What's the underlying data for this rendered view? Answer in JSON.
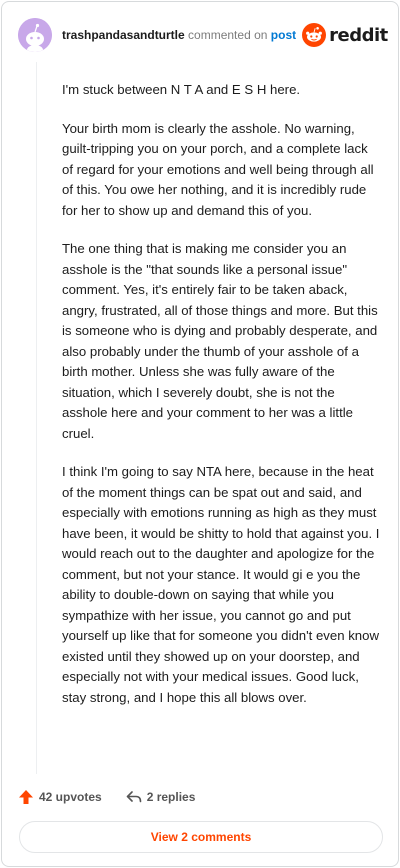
{
  "header": {
    "author": "trashpandasandturtle",
    "commented_on": "commented on",
    "post_link": "post",
    "brand": "reddit"
  },
  "comment": {
    "paragraphs": [
      "I'm stuck between N T A and E S H here.",
      "Your birth mom is clearly the asshole. No warning, guilt-tripping you on your porch, and a complete lack of regard for your emotions and well being through all of this. You owe her nothing, and it is incredibly rude for her to show up and demand this of you.",
      "The one thing that is making me consider you an asshole is the \"that sounds like a personal issue\" comment. Yes, it's entirely fair to be taken aback, angry, frustrated, all of those things and more. But this is someone who is dying and probably desperate, and also probably under the thumb of your asshole of a birth mother. Unless she was fully aware of the situation, which I severely doubt, she is not the asshole here and your comment to her was a little cruel.",
      "I think I'm going to say NTA here, because in the heat of the moment things can be spat out and said, and especially with emotions running as high as they must have been, it would be shitty to hold that against you. I would reach out to the daughter and apologize for the comment, but not your stance. It would gi e you the ability to double-down on saying that while you sympathize with her issue, you cannot go and put yourself up like that for someone you didn't even know existed until they showed up on your doorstep, and especially not with your medical issues. Good luck, stay strong, and I hope this all blows over."
    ]
  },
  "actions": {
    "upvotes": "42 upvotes",
    "replies": "2 replies"
  },
  "view_comments": "View 2 comments",
  "colors": {
    "accent": "#ff4500",
    "link": "#0079d3",
    "avatar": "#c8a8e9"
  },
  "icons": [
    "snoo-avatar-icon",
    "reddit-logo-icon",
    "upvote-arrow-icon",
    "reply-arrow-icon"
  ]
}
